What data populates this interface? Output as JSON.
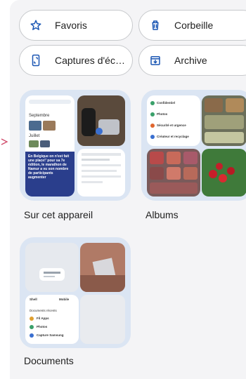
{
  "shortcuts": {
    "favorites_label": "Favoris",
    "trash_label": "Corbeille",
    "screenshots_label": "Captures d'éc…",
    "archive_label": "Archive",
    "icons": [
      "star-outline-icon",
      "trash-icon",
      "phone-screenshot-icon",
      "archive-icon"
    ]
  },
  "collections": {
    "on_device_label": "Sur cet appareil",
    "albums_label": "Albums",
    "documents_label": "Documents"
  },
  "thumbnail_text": {
    "month_1": "Septembre",
    "month_2": "Juillet",
    "headline": "En Belgique on n'est fait une place!' pour sa 7e édition, le marathon de Namur a vu son nombre de participants augmenter",
    "album_row_1": "Confidentiel",
    "album_row_2": "Photos",
    "album_row_3": "Sécurité et urgence",
    "album_row_4": "Créateur et recyclage",
    "doc_label_1": "Shell",
    "doc_label_2": "Mobile",
    "doc_label_3": "Documents récents",
    "doc_item_1": "Fil Apps",
    "doc_item_2": "Photos",
    "doc_item_3": "Capture Samsung"
  },
  "colors": {
    "tile_bg": "#dbe5f3",
    "icon_blue": "#1a56b3",
    "chip_border": "#c7c9cc",
    "sheet_bg": "#f4f4f6",
    "accent_pink": "#d04a6a"
  }
}
